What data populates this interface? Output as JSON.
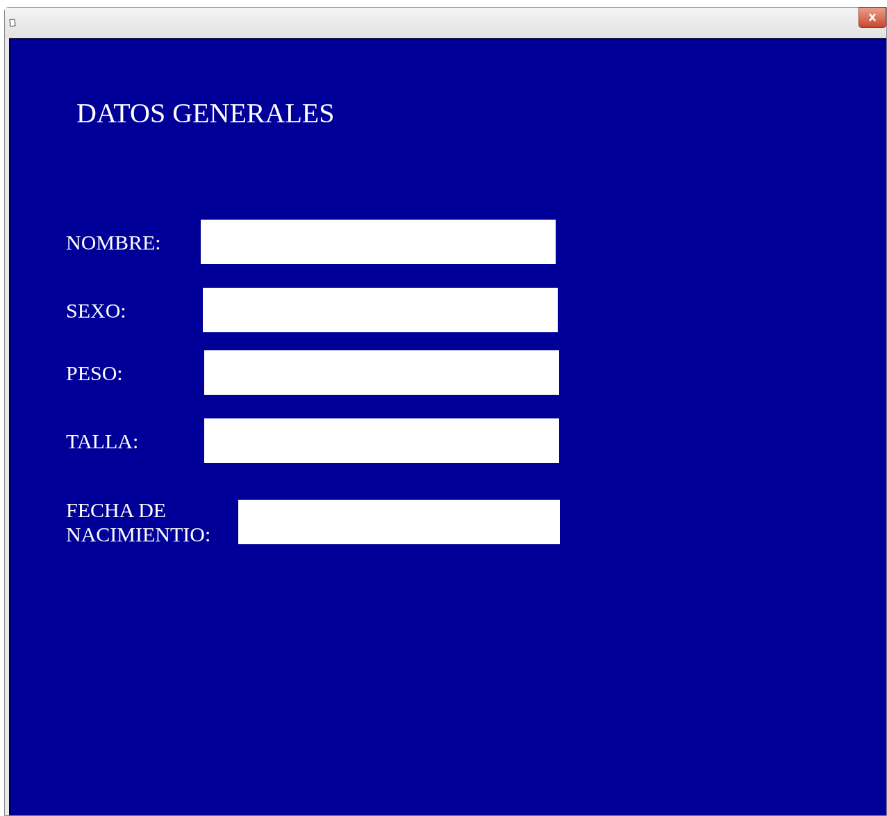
{
  "title": "DATOS GENERALES",
  "fields": [
    {
      "label": "NOMBRE:"
    },
    {
      "label": "SEXO:"
    },
    {
      "label": "PESO:"
    },
    {
      "label": "TALLA:"
    },
    {
      "label": "FECHA DE NACIMIENTIO:"
    }
  ]
}
